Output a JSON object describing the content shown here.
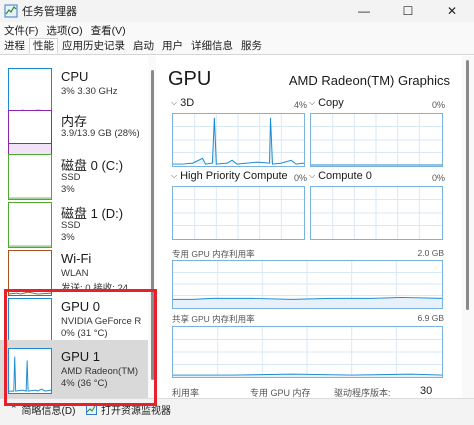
{
  "window": {
    "title": "任务管理器",
    "controls": {
      "minimize": "—",
      "maximize": "☐",
      "close": "✕"
    }
  },
  "menu": [
    "文件(F)",
    "选项(O)",
    "查看(V)"
  ],
  "tabs": [
    "进程",
    "性能",
    "应用历史记录",
    "启动",
    "用户",
    "详细信息",
    "服务"
  ],
  "active_tab": "性能",
  "resources": [
    {
      "name": "CPU",
      "sub1": "3% 3.30 GHz",
      "sub2": "",
      "color": "#1b8bd1"
    },
    {
      "name": "内存",
      "sub1": "3.9/13.9 GB (28%)",
      "sub2": "",
      "color": "#8b26b2"
    },
    {
      "name": "磁盘 0 (C:)",
      "sub1": "SSD",
      "sub2": "3%",
      "color": "#4fa82f"
    },
    {
      "name": "磁盘 1 (D:)",
      "sub1": "SSD",
      "sub2": "3%",
      "color": "#4fa82f"
    },
    {
      "name": "Wi-Fi",
      "sub1": "WLAN",
      "sub2": "发送: 0 接收: 24",
      "color": "#a6531f"
    },
    {
      "name": "GPU 0",
      "sub1": "NVIDIA GeForce R...",
      "sub2": "0% (31 °C)",
      "color": "#1b8bd1"
    },
    {
      "name": "GPU 1",
      "sub1": "AMD Radeon(TM)",
      "sub2": "4% (36 °C)",
      "color": "#1b8bd1"
    }
  ],
  "detail": {
    "title": "GPU",
    "model": "AMD Radeon(TM) Graphics",
    "engines": [
      {
        "name": "3D",
        "pct": "4%"
      },
      {
        "name": "Copy",
        "pct": "0%"
      },
      {
        "name": "High Priority Compute",
        "pct": "0%"
      },
      {
        "name": "Compute 0",
        "pct": "0%"
      }
    ],
    "dedicated_mem": {
      "label": "专用 GPU 内存利用率",
      "max": "2.0 GB"
    },
    "shared_mem": {
      "label": "共享 GPU 内存利用率",
      "max": "6.9 GB"
    },
    "bottom_labels": [
      "利用率",
      "专用 GPU 内存",
      "驱动程序版本:",
      "30"
    ]
  },
  "footer": {
    "brief": "简略信息(D)",
    "open_monitor": "打开资源监视器"
  },
  "accent_color": "#1b8bd1",
  "highlight_color": "#e8202a"
}
